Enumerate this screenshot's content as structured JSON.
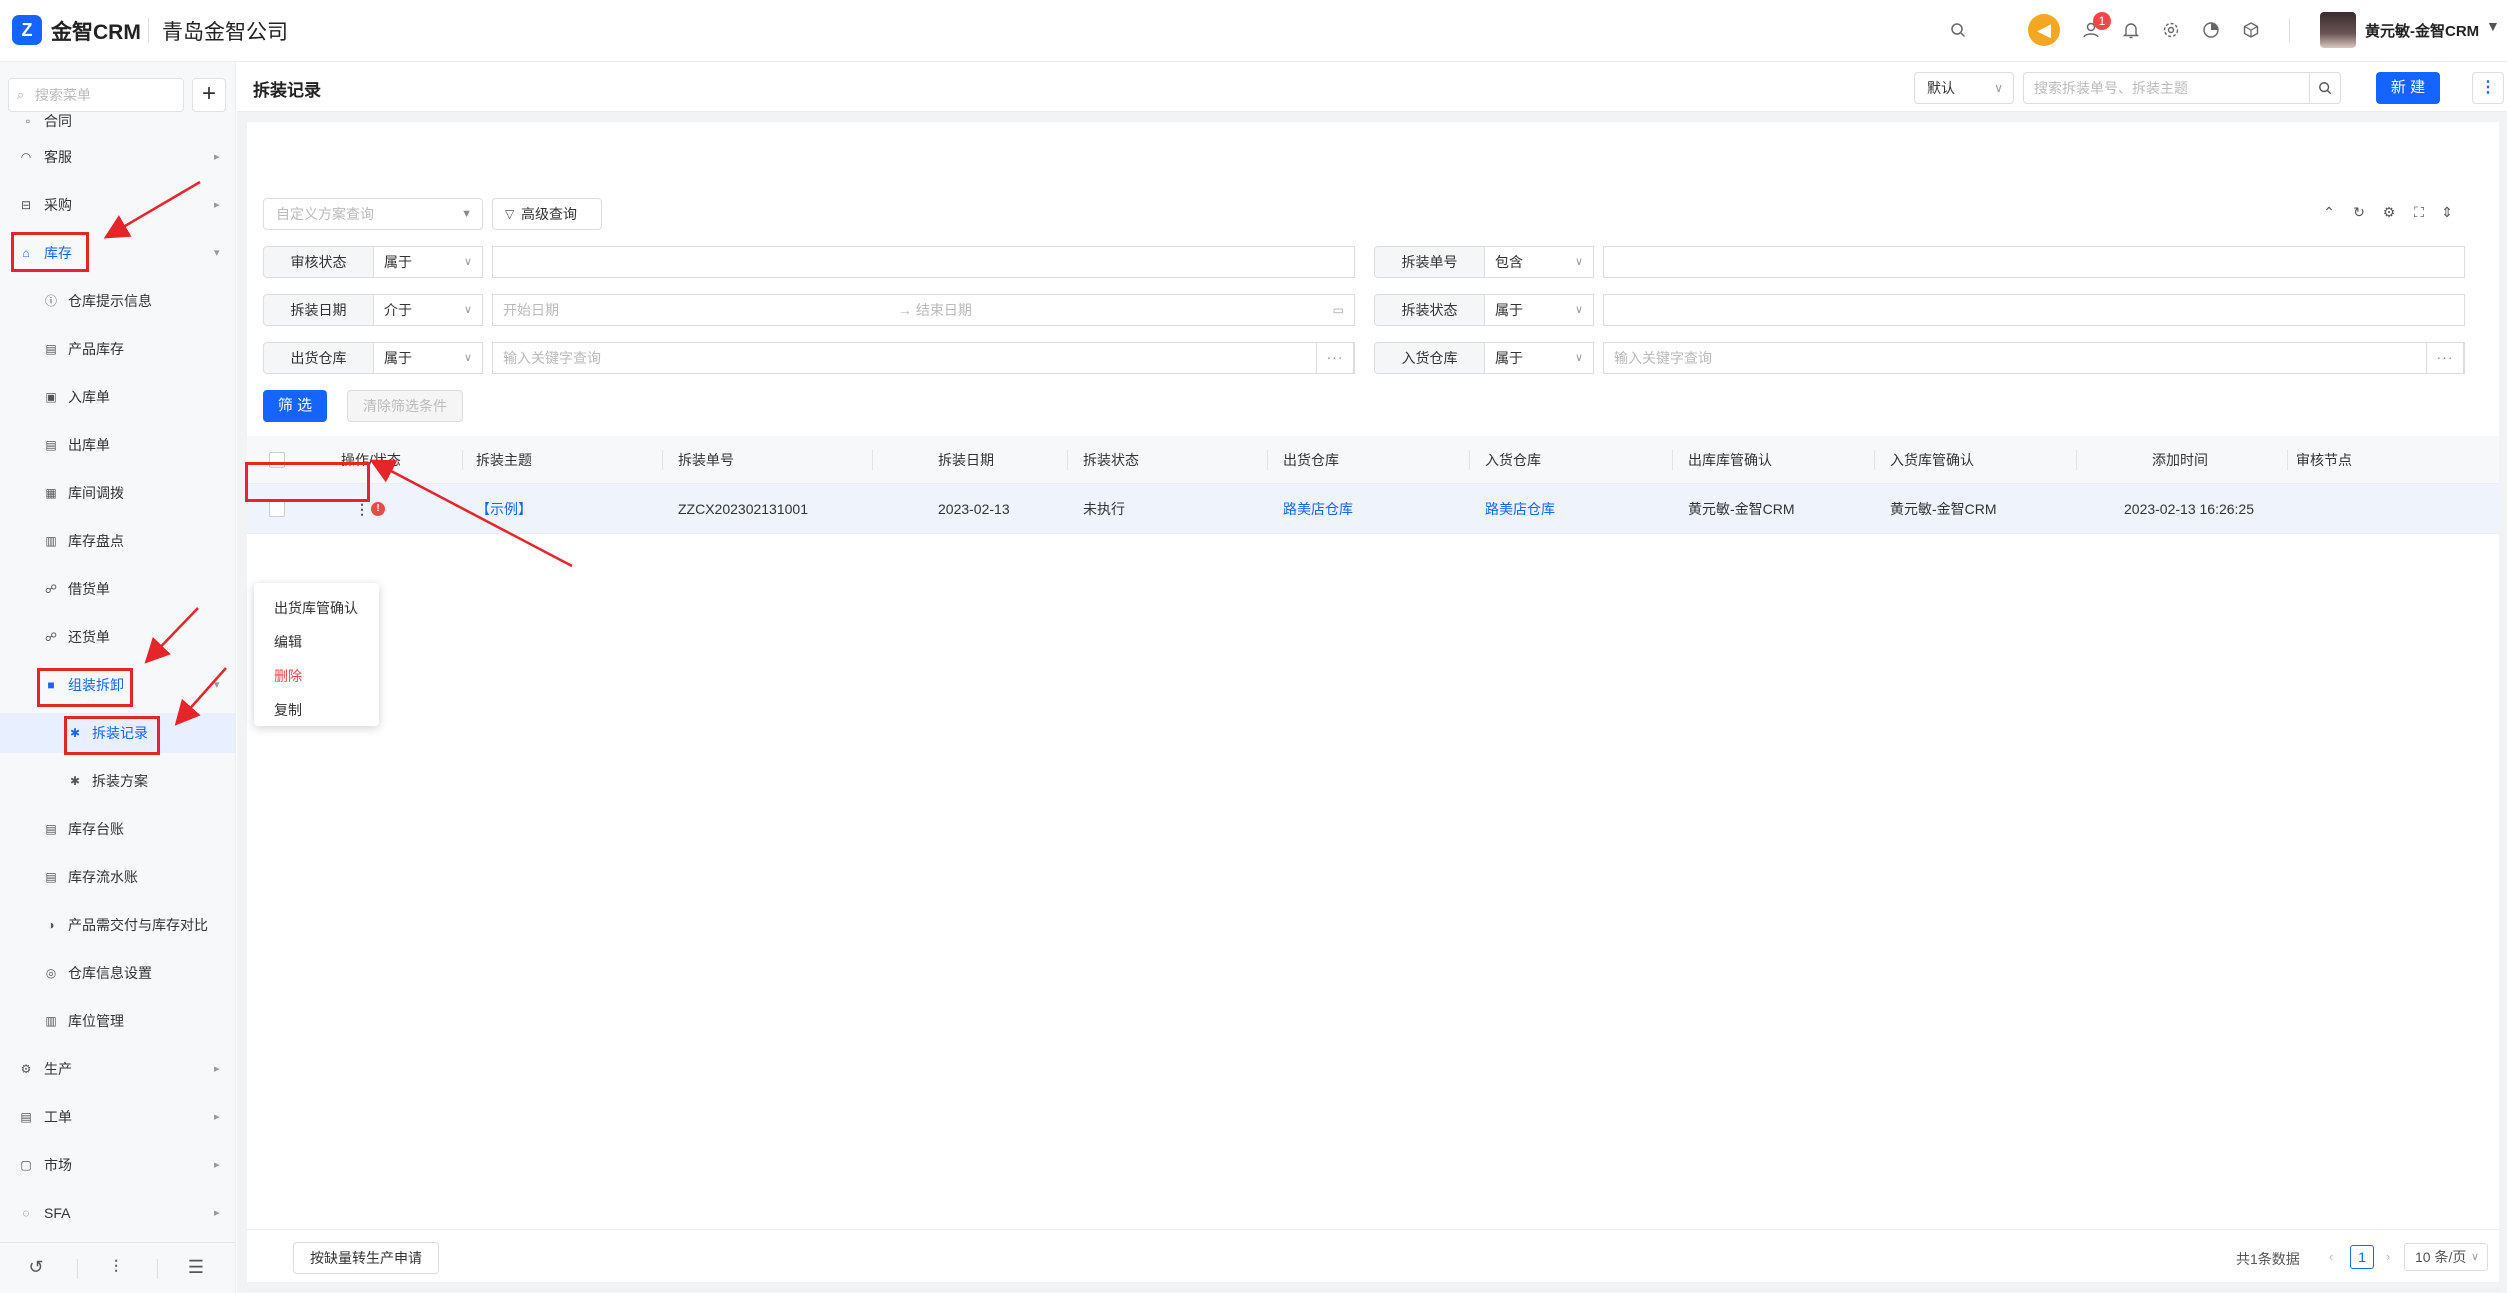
{
  "header": {
    "logo_glyph": "Z",
    "app_name": "金智CRM",
    "company": "青岛金智公司",
    "notification_count": "1",
    "user_name": "黄元敏-金智CRM",
    "icons": [
      "search-icon",
      "broadcast-icon",
      "contacts-icon",
      "bell-icon",
      "gear-icon",
      "pie-chart-icon",
      "box-icon"
    ]
  },
  "sidebar": {
    "search_placeholder": "搜索菜单",
    "add_label": "+",
    "top_clipped": "合同",
    "items": [
      {
        "label": "客服"
      },
      {
        "label": "采购"
      },
      {
        "label": "库存"
      },
      {
        "label": "仓库提示信息"
      },
      {
        "label": "产品库存"
      },
      {
        "label": "入库单"
      },
      {
        "label": "出库单"
      },
      {
        "label": "库间调拨"
      },
      {
        "label": "库存盘点"
      },
      {
        "label": "借货单"
      },
      {
        "label": "还货单"
      },
      {
        "label": "组装拆卸"
      },
      {
        "label": "拆装记录"
      },
      {
        "label": "拆装方案"
      },
      {
        "label": "库存台账"
      },
      {
        "label": "库存流水账"
      },
      {
        "label": "产品需交付与库存对比"
      },
      {
        "label": "仓库信息设置"
      },
      {
        "label": "库位管理"
      },
      {
        "label": "生产"
      },
      {
        "label": "工单"
      },
      {
        "label": "市场"
      },
      {
        "label": "SFA"
      }
    ]
  },
  "page": {
    "title": "拆装记录",
    "view_select": "默认",
    "search_placeholder": "搜索拆装单号、拆装主题",
    "new_button": "新 建",
    "more_button": "⋮"
  },
  "filters": {
    "scheme_placeholder": "自定义方案查询",
    "advanced_query": "高级查询",
    "rows": [
      {
        "label": "审核状态",
        "op": "属于",
        "value": ""
      },
      {
        "label": "拆装单号",
        "op": "包含",
        "value": ""
      },
      {
        "label": "拆装日期",
        "op": "介于",
        "start": "开始日期",
        "end": "结束日期"
      },
      {
        "label": "拆装状态",
        "op": "属于",
        "value": ""
      },
      {
        "label": "出货仓库",
        "op": "属于",
        "placeholder": "输入关键字查询"
      },
      {
        "label": "入货仓库",
        "op": "属于",
        "placeholder": "输入关键字查询"
      }
    ],
    "date_arrow": "→",
    "dots": "···",
    "filter_button": "筛 选",
    "clear_button": "清除筛选条件"
  },
  "table": {
    "columns": [
      "操作/状态",
      "拆装主题",
      "拆装单号",
      "拆装日期",
      "拆装状态",
      "出货仓库",
      "入货仓库",
      "出库库管确认",
      "入货库管确认",
      "添加时间",
      "审核节点"
    ],
    "rows": [
      {
        "subject": "【示例】",
        "number": "ZZCX202302131001",
        "date": "2023-02-13",
        "status": "未执行",
        "out_warehouse": "路美店仓库",
        "in_warehouse": "路美店仓库",
        "out_confirm": "黄元敏-金智CRM",
        "in_confirm": "黄元敏-金智CRM",
        "added": "2023-02-13 16:26:25",
        "node": ""
      }
    ]
  },
  "row_menu": {
    "items": [
      "出货库管确认",
      "编辑",
      "删除",
      "复制"
    ]
  },
  "footer": {
    "batch_button": "按缺量转生产申请",
    "total": "共1条数据",
    "page": "1",
    "page_size": "10 条/页"
  },
  "colors": {
    "accent": "#1664ff",
    "annotation": "#e5252a",
    "danger": "#f04848"
  }
}
